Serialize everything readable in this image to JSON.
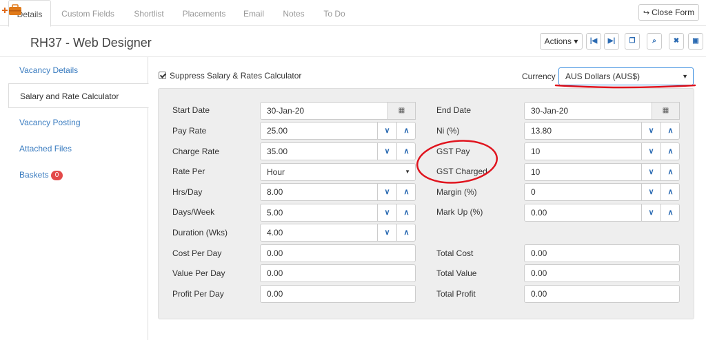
{
  "tabs": [
    "Details",
    "Custom Fields",
    "Shortlist",
    "Placements",
    "Email",
    "Notes",
    "To Do"
  ],
  "close_form": "Close Form",
  "title": "RH37 - Web Designer",
  "actions_label": "Actions",
  "sidebar": {
    "items": [
      {
        "label": "Vacancy Details"
      },
      {
        "label": "Salary and Rate Calculator"
      },
      {
        "label": "Vacancy Posting"
      },
      {
        "label": "Attached Files"
      },
      {
        "label": "Baskets",
        "badge": "0"
      }
    ]
  },
  "suppress_label": "Suppress Salary & Rates Calculator",
  "currency": {
    "label": "Currency",
    "value": "AUS Dollars (AUS$)"
  },
  "left_fields": {
    "start_date": {
      "label": "Start Date",
      "value": "30-Jan-20"
    },
    "pay_rate": {
      "label": "Pay Rate",
      "value": "25.00"
    },
    "charge_rate": {
      "label": "Charge Rate",
      "value": "35.00"
    },
    "rate_per": {
      "label": "Rate Per",
      "value": "Hour"
    },
    "hrs_day": {
      "label": "Hrs/Day",
      "value": "8.00"
    },
    "days_week": {
      "label": "Days/Week",
      "value": "5.00"
    },
    "duration": {
      "label": "Duration (Wks)",
      "value": "4.00"
    },
    "cost_per_day": {
      "label": "Cost Per Day",
      "value": "0.00"
    },
    "value_per_day": {
      "label": "Value Per Day",
      "value": "0.00"
    },
    "profit_per_day": {
      "label": "Profit Per Day",
      "value": "0.00"
    }
  },
  "right_fields": {
    "end_date": {
      "label": "End Date",
      "value": "30-Jan-20"
    },
    "ni": {
      "label": "Ni (%)",
      "value": "13.80"
    },
    "gst_pay": {
      "label": "GST Pay",
      "value": "10"
    },
    "gst_charged": {
      "label": "GST Charged",
      "value": "10"
    },
    "margin": {
      "label": "Margin (%)",
      "value": "0"
    },
    "mark_up": {
      "label": "Mark Up (%)",
      "value": "0.00"
    },
    "total_cost": {
      "label": "Total Cost",
      "value": "0.00"
    },
    "total_value": {
      "label": "Total Value",
      "value": "0.00"
    },
    "total_profit": {
      "label": "Total Profit",
      "value": "0.00"
    }
  },
  "colors": {
    "link": "#3a7cc0",
    "annotation": "#e0141e",
    "badge": "#e34a4a"
  }
}
